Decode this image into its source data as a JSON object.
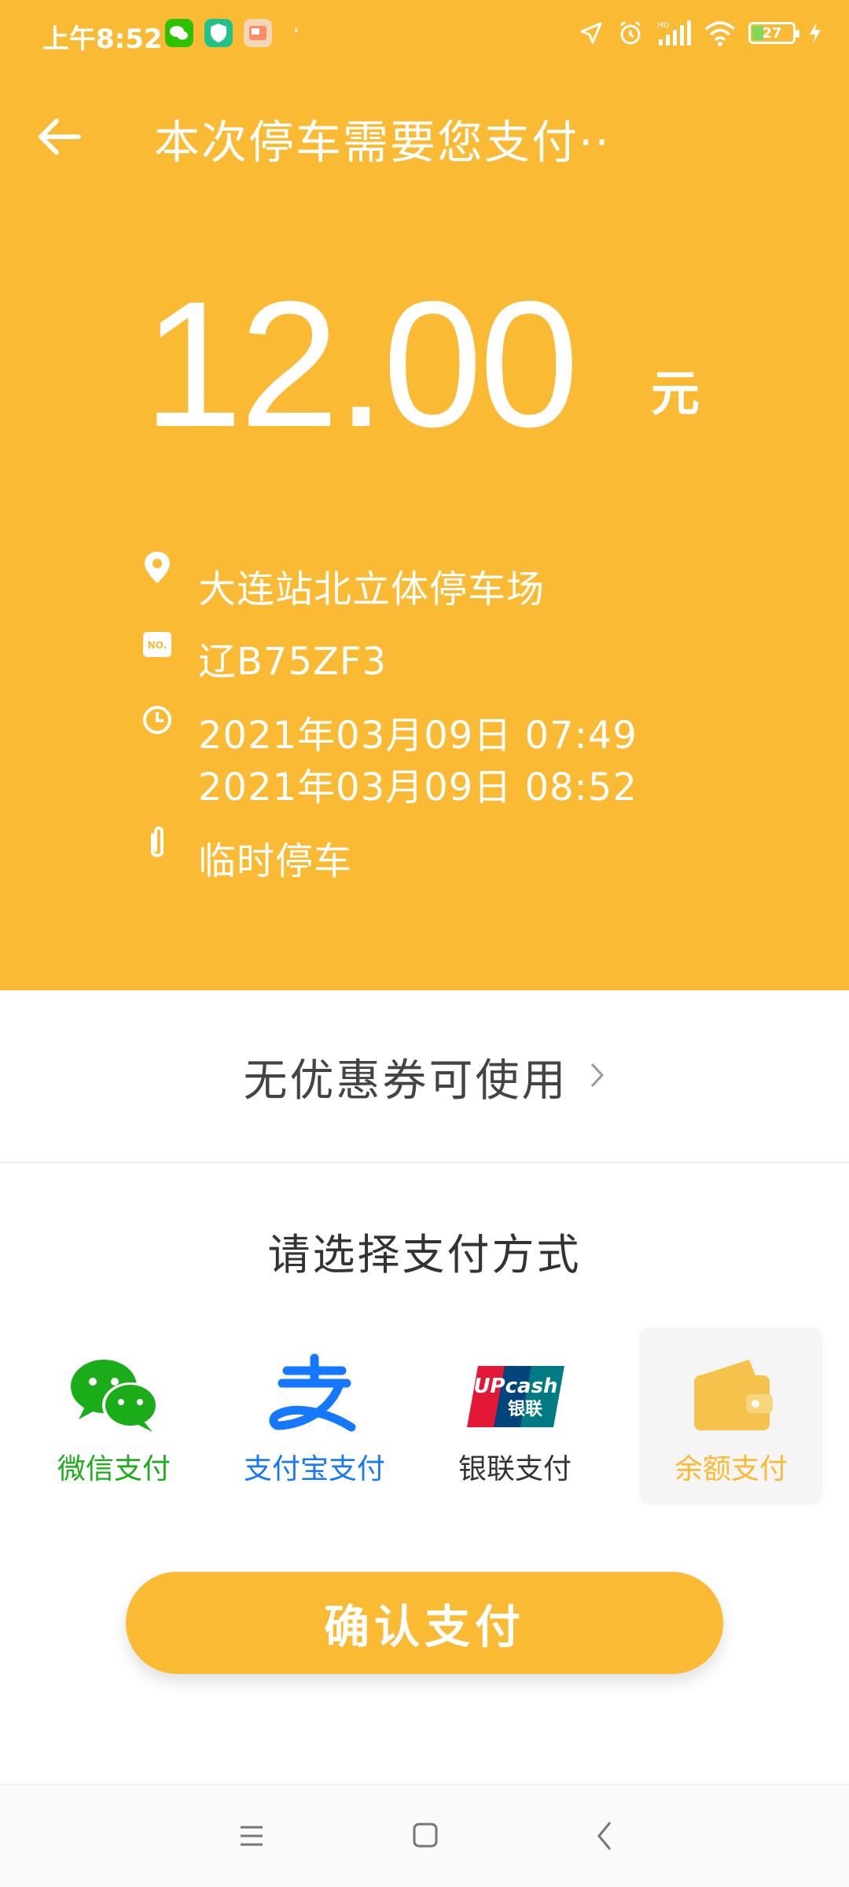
{
  "status_bar": {
    "time": "上午8:52",
    "dot": "·",
    "hd_label": "HD",
    "battery": "27"
  },
  "header": {
    "title": "本次停车需要您支付··"
  },
  "amount": {
    "value": "12.00",
    "unit": "元"
  },
  "info": {
    "location": "大连站北立体停车场",
    "plate_badge": "NO.",
    "plate": "辽B75ZF3",
    "time_in": "2021年03月09日 07:49",
    "time_out": "2021年03月09日 08:52",
    "type": "临时停车"
  },
  "coupon": {
    "label": "无优惠券可使用",
    "arrow": "›"
  },
  "payment": {
    "title": "请选择支付方式",
    "options": [
      {
        "label": "微信支付",
        "color": "#1aad19"
      },
      {
        "label": "支付宝支付",
        "color": "#1677ff"
      },
      {
        "label": "银联支付",
        "color": "#333333"
      },
      {
        "label": "余额支付",
        "color": "#fbba33"
      }
    ],
    "unionpay_logo_text": "UPcash",
    "unionpay_logo_cn": "银联",
    "selected": "余额支付"
  },
  "confirm_button": {
    "label": "确认支付"
  },
  "colors": {
    "accent": "#fbba33"
  }
}
